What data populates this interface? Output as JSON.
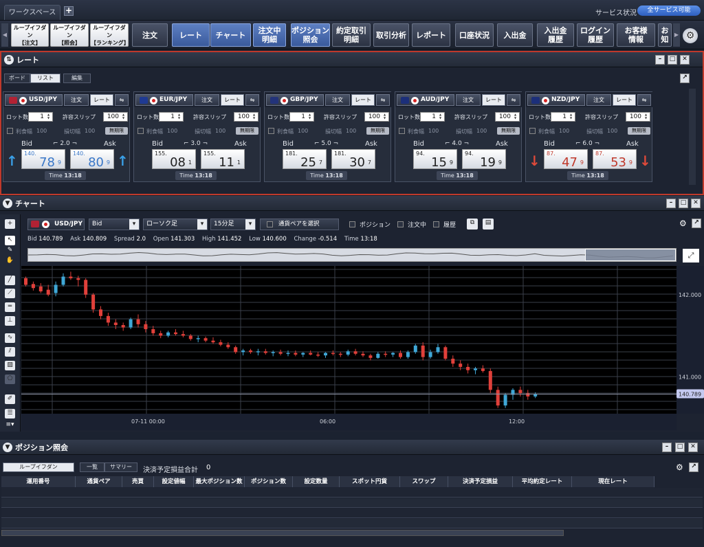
{
  "topbar": {
    "tab": "ワークスペース",
    "add": "+",
    "service_label": "サービス状況",
    "service_status": "全サービス可能"
  },
  "toolbar": {
    "buttons": [
      {
        "label": "ループイフダン\n【注文】",
        "style": "light"
      },
      {
        "label": "ループイフダン\n【照会】",
        "style": "light"
      },
      {
        "label": "ループイフダン\n【ランキング】",
        "style": "light"
      },
      {
        "label": "注文",
        "style": "dark"
      },
      {
        "label": "レート",
        "style": "sel"
      },
      {
        "label": "チャート",
        "style": "sel"
      },
      {
        "label": "注文中\n明細",
        "style": "sel"
      },
      {
        "label": "ポジション\n照会",
        "style": "sel"
      },
      {
        "label": "約定取引\n明細",
        "style": "dark"
      },
      {
        "label": "取引分析",
        "style": "dark"
      },
      {
        "label": "レポート",
        "style": "dark"
      },
      {
        "label": "口座状況",
        "style": "dark"
      },
      {
        "label": "入出金",
        "style": "dark"
      },
      {
        "label": "入出金\n履歴",
        "style": "dark"
      },
      {
        "label": "ログイン\n履歴",
        "style": "dark"
      },
      {
        "label": "お客様\n情報",
        "style": "dark"
      },
      {
        "label": "お知",
        "style": "dark"
      }
    ]
  },
  "rate_panel": {
    "title": "レート",
    "subtabs": [
      "ボード",
      "リスト",
      "編集"
    ],
    "labels": {
      "order": "注文",
      "rate": "レート",
      "lot": "ロット数",
      "slip": "許容スリップ",
      "rikui": "利食幅",
      "sonkiri": "損切幅",
      "mugen": "無期限",
      "bid": "Bid",
      "ask": "Ask",
      "time": "Time"
    },
    "cards": [
      {
        "pair": "USD/JPY",
        "lot": "1",
        "slip": "100",
        "rikui": "100",
        "sonkiri": "100",
        "spread": "2.0",
        "bid_small": "140.",
        "bid_big": "78",
        "bid_frac": "9",
        "ask_small": "140.",
        "ask_big": "80",
        "ask_frac": "9",
        "time": "13:18",
        "dir": "up",
        "flag_color": "#b22234",
        "arrow": "↑",
        "arrow_color": "#3aa0e8",
        "price_color": "#3a78c8"
      },
      {
        "pair": "EUR/JPY",
        "lot": "1",
        "slip": "100",
        "rikui": "100",
        "sonkiri": "100",
        "spread": "3.0",
        "bid_small": "155.",
        "bid_big": "08",
        "bid_frac": "1",
        "ask_small": "155.",
        "ask_big": "11",
        "ask_frac": "1",
        "time": "13:18",
        "dir": "none",
        "flag_color": "#1f3a93",
        "arrow": "",
        "arrow_color": "#3aa0e8",
        "price_color": "#222222"
      },
      {
        "pair": "GBP/JPY",
        "lot": "1",
        "slip": "100",
        "rikui": "100",
        "sonkiri": "100",
        "spread": "5.0",
        "bid_small": "181.",
        "bid_big": "25",
        "bid_frac": "7",
        "ask_small": "181.",
        "ask_big": "30",
        "ask_frac": "7",
        "time": "13:18",
        "dir": "none",
        "flag_color": "#23337a",
        "arrow": "",
        "arrow_color": "#3aa0e8",
        "price_color": "#222222"
      },
      {
        "pair": "AUD/JPY",
        "lot": "1",
        "slip": "100",
        "rikui": "100",
        "sonkiri": "100",
        "spread": "4.0",
        "bid_small": "94.",
        "bid_big": "15",
        "bid_frac": "9",
        "ask_small": "94.",
        "ask_big": "19",
        "ask_frac": "9",
        "time": "13:18",
        "dir": "none",
        "flag_color": "#1c2f7a",
        "arrow": "",
        "arrow_color": "#3aa0e8",
        "price_color": "#222222"
      },
      {
        "pair": "NZD/JPY",
        "lot": "1",
        "slip": "100",
        "rikui": "100",
        "sonkiri": "100",
        "spread": "6.0",
        "bid_small": "87.",
        "bid_big": "47",
        "bid_frac": "9",
        "ask_small": "87.",
        "ask_big": "53",
        "ask_frac": "9",
        "time": "13:18",
        "dir": "down",
        "flag_color": "#1c2f7a",
        "arrow": "↓",
        "arrow_color": "#e04a3a",
        "price_color": "#c0392b"
      }
    ]
  },
  "chart_panel": {
    "title": "チャート",
    "pair": "USD/JPY",
    "price_type": "Bid",
    "chart_type": "ローソク足",
    "timeframe": "15分足",
    "select_pair": "通貨ペアを選択",
    "checks": [
      "ポジション",
      "注文中",
      "履歴"
    ],
    "info": {
      "bid_label": "Bid",
      "bid": "140.789",
      "ask_label": "Ask",
      "ask": "140.809",
      "spread_label": "Spread",
      "spread": "2.0",
      "open_label": "Open",
      "open": "141.303",
      "high_label": "High",
      "high": "141.452",
      "low_label": "Low",
      "low": "140.600",
      "change_label": "Change",
      "change": "-0.514",
      "time_label": "Time",
      "time": "13:18"
    }
  },
  "chart_data": {
    "type": "candlestick",
    "x_ticks": [
      "07-11 00:00",
      "06:00",
      "12:00"
    ],
    "y_ticks": [
      "142.000",
      "141.000"
    ],
    "ylim": [
      140.55,
      142.35
    ],
    "last_price": "140.789",
    "candles": [
      [
        142.2,
        142.22,
        142.1,
        142.12
      ],
      [
        142.13,
        142.16,
        142.05,
        142.08
      ],
      [
        142.1,
        142.14,
        142.02,
        142.04
      ],
      [
        142.06,
        142.12,
        141.98,
        142.0
      ],
      [
        142.02,
        142.16,
        141.98,
        142.12
      ],
      [
        142.12,
        142.26,
        142.1,
        142.22
      ],
      [
        142.22,
        142.28,
        142.18,
        142.2
      ],
      [
        142.2,
        142.23,
        142.1,
        142.18
      ],
      [
        142.18,
        142.2,
        141.96,
        142.0
      ],
      [
        142.0,
        142.02,
        141.78,
        141.82
      ],
      [
        141.82,
        141.86,
        141.7,
        141.74
      ],
      [
        141.74,
        141.78,
        141.62,
        141.66
      ],
      [
        141.66,
        141.7,
        141.58,
        141.63
      ],
      [
        141.63,
        141.66,
        141.56,
        141.6
      ],
      [
        141.6,
        141.72,
        141.58,
        141.7
      ],
      [
        141.7,
        141.76,
        141.6,
        141.64
      ],
      [
        141.64,
        141.68,
        141.54,
        141.58
      ],
      [
        141.58,
        141.62,
        141.5,
        141.53
      ],
      [
        141.53,
        141.56,
        141.47,
        141.5
      ],
      [
        141.5,
        141.56,
        141.48,
        141.54
      ],
      [
        141.54,
        141.58,
        141.5,
        141.52
      ],
      [
        141.52,
        141.56,
        141.48,
        141.5
      ],
      [
        141.5,
        141.52,
        141.44,
        141.46
      ],
      [
        141.46,
        141.5,
        141.42,
        141.47
      ],
      [
        141.47,
        141.49,
        141.42,
        141.44
      ],
      [
        141.44,
        141.48,
        141.4,
        141.42
      ],
      [
        141.42,
        141.45,
        141.37,
        141.39
      ],
      [
        141.39,
        141.42,
        141.34,
        141.36
      ],
      [
        141.36,
        141.38,
        141.28,
        141.3
      ],
      [
        141.3,
        141.34,
        141.26,
        141.32
      ],
      [
        141.32,
        141.34,
        141.28,
        141.3
      ],
      [
        141.3,
        141.34,
        141.26,
        141.31
      ],
      [
        141.31,
        141.34,
        141.27,
        141.29
      ],
      [
        141.29,
        141.32,
        141.25,
        141.3
      ],
      [
        141.3,
        141.33,
        141.26,
        141.28
      ],
      [
        141.28,
        141.32,
        141.25,
        141.29
      ],
      [
        141.29,
        141.32,
        141.25,
        141.27
      ],
      [
        141.27,
        141.3,
        141.24,
        141.29
      ],
      [
        141.29,
        141.32,
        141.26,
        141.27
      ],
      [
        141.27,
        141.3,
        141.24,
        141.26
      ],
      [
        141.26,
        141.3,
        141.23,
        141.29
      ],
      [
        141.29,
        141.32,
        141.26,
        141.28
      ],
      [
        141.28,
        141.3,
        141.24,
        141.27
      ],
      [
        141.27,
        141.33,
        141.25,
        141.31
      ],
      [
        141.31,
        141.34,
        141.26,
        141.28
      ],
      [
        141.28,
        141.31,
        141.24,
        141.26
      ],
      [
        141.26,
        141.28,
        141.2,
        141.23
      ],
      [
        141.23,
        141.3,
        141.22,
        141.28
      ],
      [
        141.28,
        141.31,
        141.24,
        141.27
      ],
      [
        141.27,
        141.3,
        141.24,
        141.29
      ],
      [
        141.29,
        141.32,
        141.22,
        141.24
      ],
      [
        141.24,
        141.32,
        141.22,
        141.3
      ],
      [
        141.3,
        141.4,
        141.28,
        141.38
      ],
      [
        141.38,
        141.42,
        141.2,
        141.24
      ],
      [
        141.24,
        141.33,
        141.22,
        141.3
      ],
      [
        141.3,
        141.4,
        141.28,
        141.36
      ],
      [
        141.36,
        141.38,
        141.2,
        141.22
      ],
      [
        141.22,
        141.26,
        141.12,
        141.16
      ],
      [
        141.16,
        141.2,
        141.08,
        141.12
      ],
      [
        141.12,
        141.16,
        141.04,
        141.08
      ],
      [
        141.08,
        141.12,
        141.03,
        141.1
      ],
      [
        141.1,
        141.14,
        141.05,
        141.07
      ],
      [
        141.07,
        141.1,
        140.8,
        140.84
      ],
      [
        140.84,
        140.88,
        140.62,
        140.65
      ],
      [
        140.65,
        140.8,
        140.62,
        140.78
      ],
      [
        140.78,
        140.86,
        140.72,
        140.84
      ],
      [
        140.84,
        140.88,
        140.76,
        140.8
      ],
      [
        140.8,
        140.84,
        140.72,
        140.76
      ],
      [
        140.76,
        140.81,
        140.74,
        140.79
      ]
    ]
  },
  "position_panel": {
    "title": "ポジション照会",
    "tab": "ループイフダン",
    "sub1": "一覧",
    "sub2": "サマリー",
    "pl_label": "決済予定損益合計",
    "pl_value": "0",
    "columns": [
      "運用番号",
      "通貨ペア",
      "売買",
      "設定値幅",
      "最大ポジション数",
      "ポジション数",
      "設定数量",
      "スポット円貨",
      "スワップ",
      "決済予定損益",
      "平均約定レート",
      "現在レート"
    ]
  }
}
